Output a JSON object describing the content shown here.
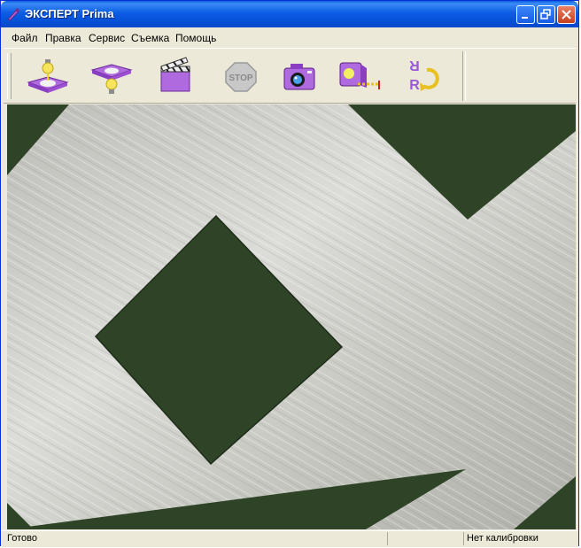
{
  "window": {
    "title": "ЭКСПЕРТ Prima"
  },
  "menu": {
    "items": [
      {
        "label": "Файл"
      },
      {
        "label": "Правка"
      },
      {
        "label": "Сервис"
      },
      {
        "label": "Съемка"
      },
      {
        "label": "Помощь"
      }
    ]
  },
  "toolbar": {
    "buttons": [
      {
        "icon": "lamp-top-icon"
      },
      {
        "icon": "lamp-bottom-icon"
      },
      {
        "icon": "clapperboard-icon"
      },
      {
        "icon": "stop-icon",
        "text": "STOP"
      },
      {
        "icon": "camera-icon"
      },
      {
        "icon": "measure-icon"
      },
      {
        "icon": "rotate-flip-icon"
      }
    ]
  },
  "statusbar": {
    "status": "Готово",
    "calibration": "Нет калибровки"
  },
  "colors": {
    "titlebar": "#0c5ce6",
    "face": "#ece9d8",
    "purple": "#b06adf",
    "metal": "#c9c9c4",
    "green_hole": "#2f4427"
  }
}
